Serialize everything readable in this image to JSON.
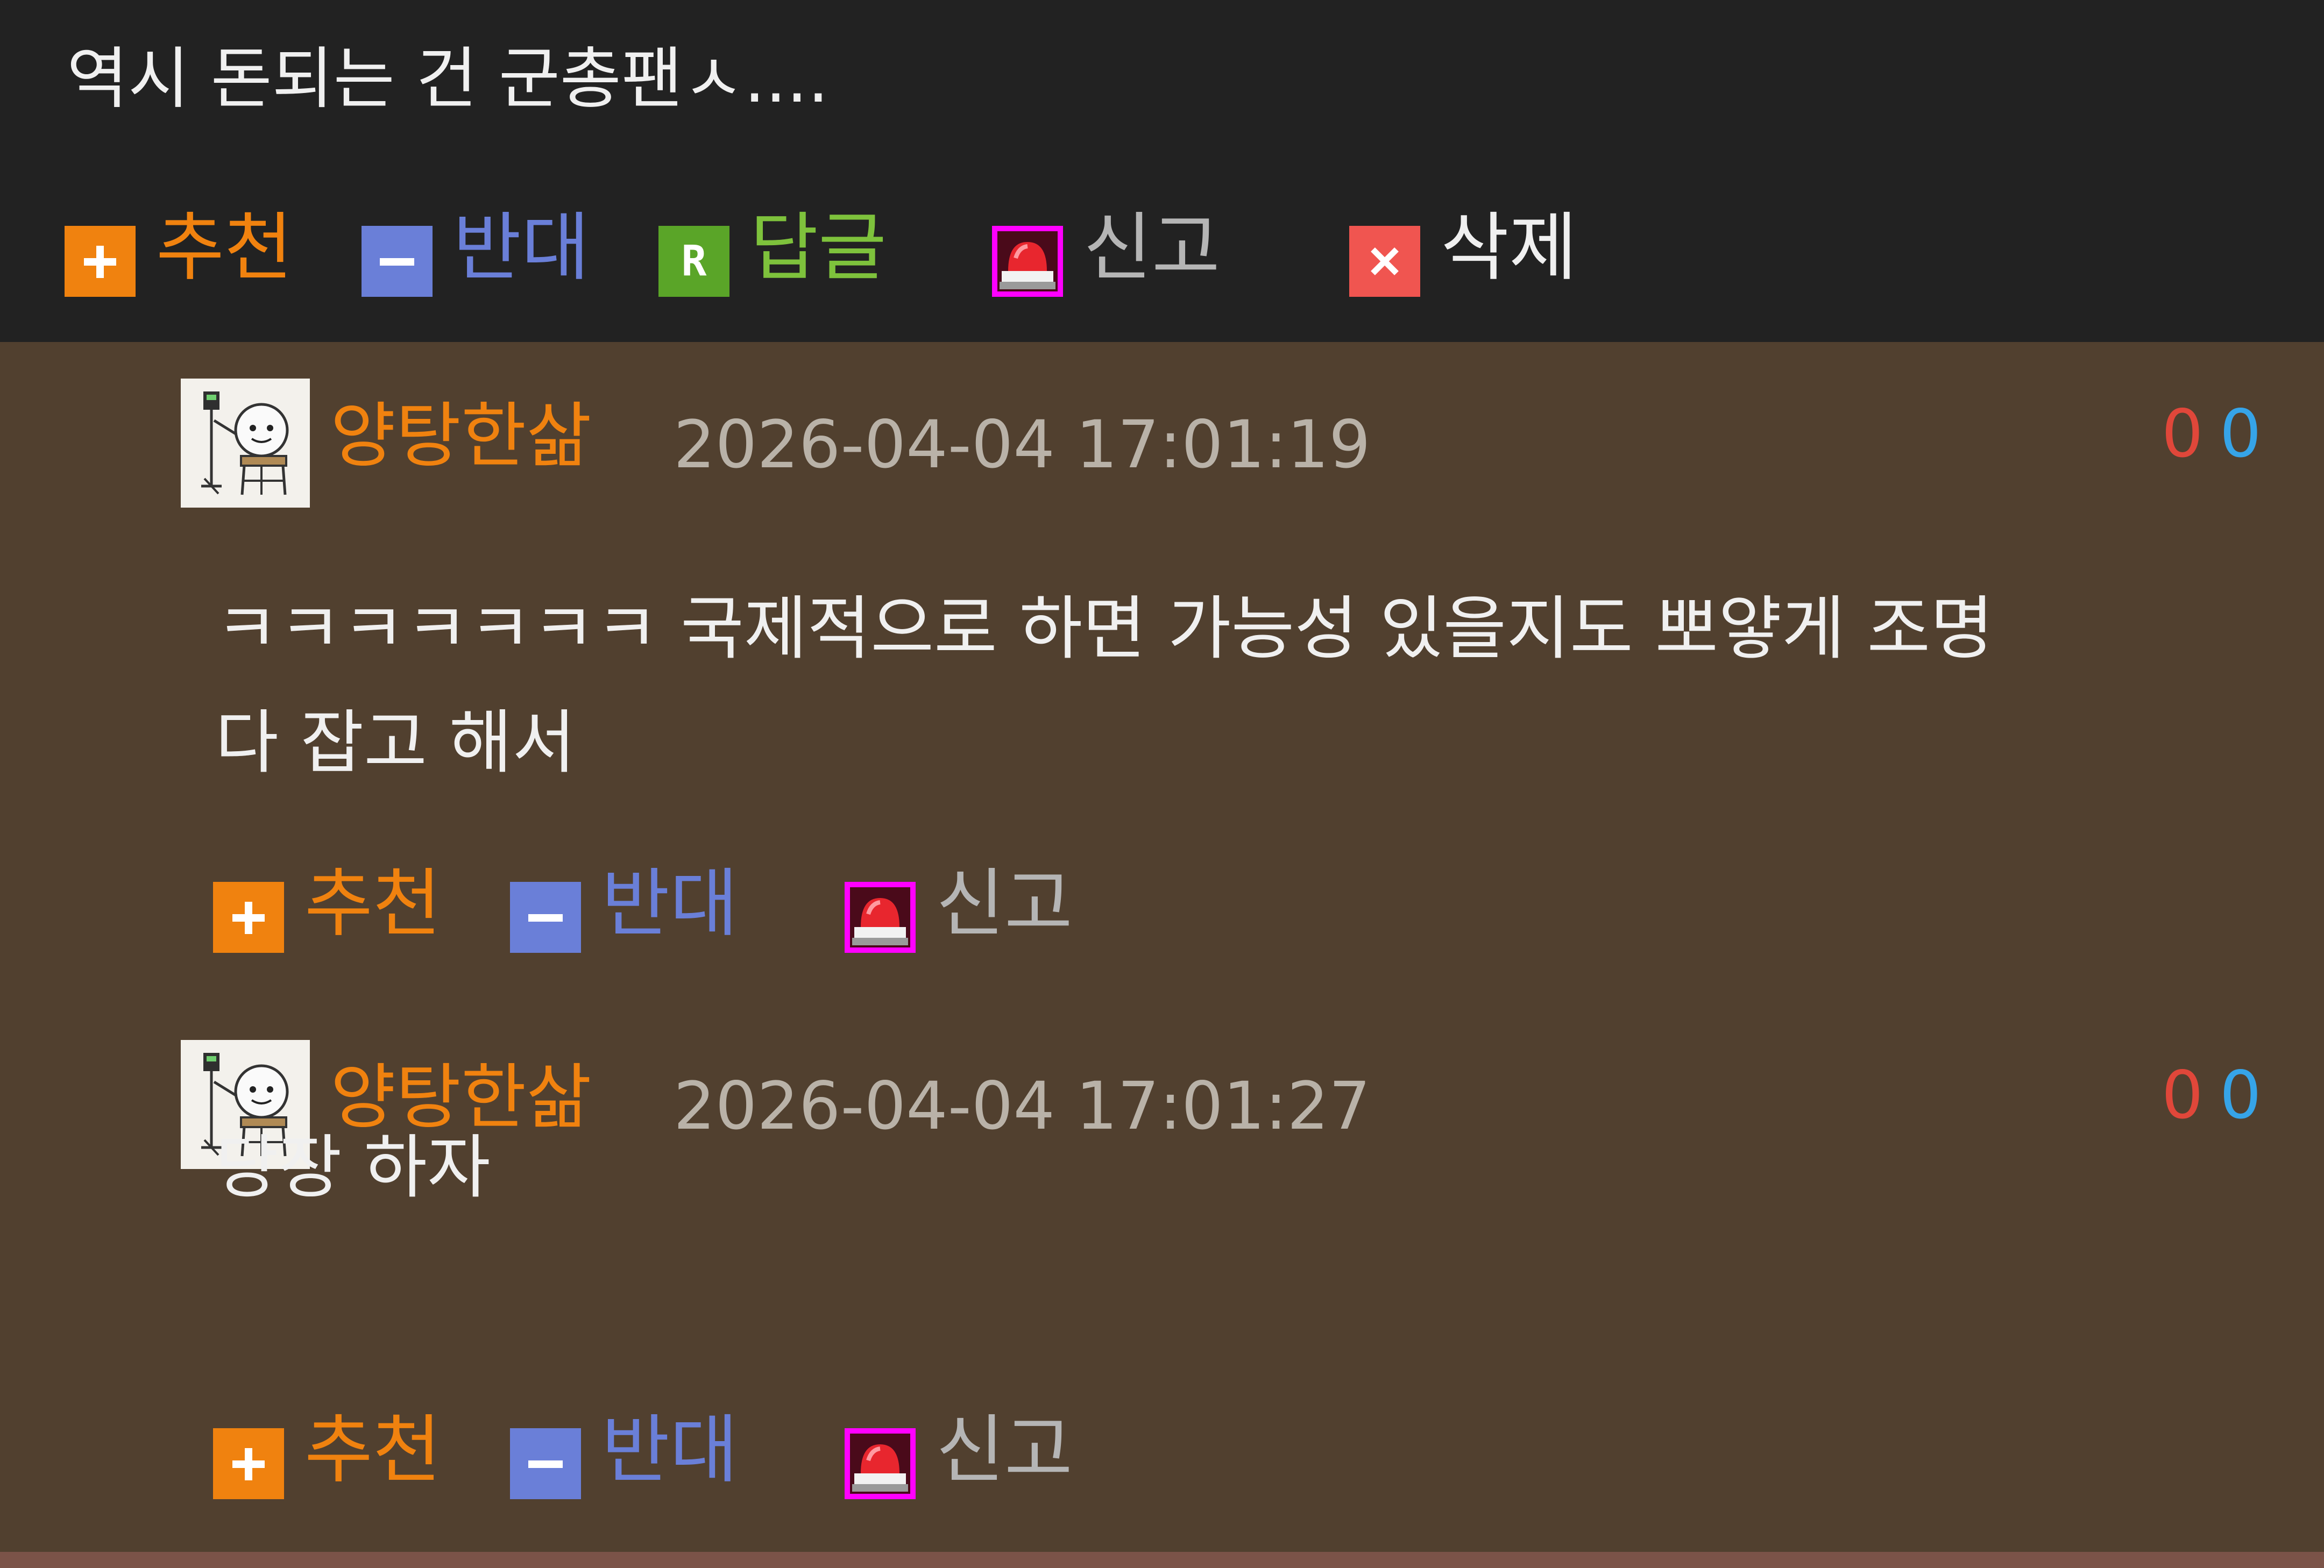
{
  "post": {
    "text": "역시 돈되는 건 군총팬ㅅ....",
    "actions": {
      "recommend": "추천",
      "oppose": "반대",
      "reply": "답글",
      "report": "신고",
      "delete": "삭제",
      "reply_icon_letter": "R"
    }
  },
  "comments": [
    {
      "nickname": "양탕한삶",
      "datetime": "2026-04-04 17:01:19",
      "votes_up": "0",
      "votes_down": "0",
      "body_lines": [
        "ㅋㅋㅋㅋㅋㅋㅋ 국제적으로 하면 가능성 있을지도 뽀얗게 조명",
        "다 잡고 해서"
      ],
      "actions": {
        "recommend": "추천",
        "oppose": "반대",
        "report": "신고"
      }
    },
    {
      "nickname": "양탕한삶",
      "datetime": "2026-04-04 17:01:27",
      "votes_up": "0",
      "votes_down": "0",
      "body_lines": [
        "당장 하자"
      ],
      "actions": {
        "recommend": "추천",
        "oppose": "반대",
        "report": "신고"
      }
    }
  ],
  "colors": {
    "header_bg": "#222222",
    "comment_bg": "#51402f",
    "recommend": "#f0820f",
    "oppose": "#6a7fd8",
    "reply": "#7ec23c",
    "report_icon": "#ff00ff",
    "delete_icon": "#f05550",
    "vote_up": "#e0473a",
    "vote_down": "#36a4e8"
  },
  "icons": {
    "recommend": "plus-icon",
    "oppose": "minus-icon",
    "reply": "reply-r-icon",
    "report": "siren-icon",
    "delete": "close-x-icon"
  }
}
